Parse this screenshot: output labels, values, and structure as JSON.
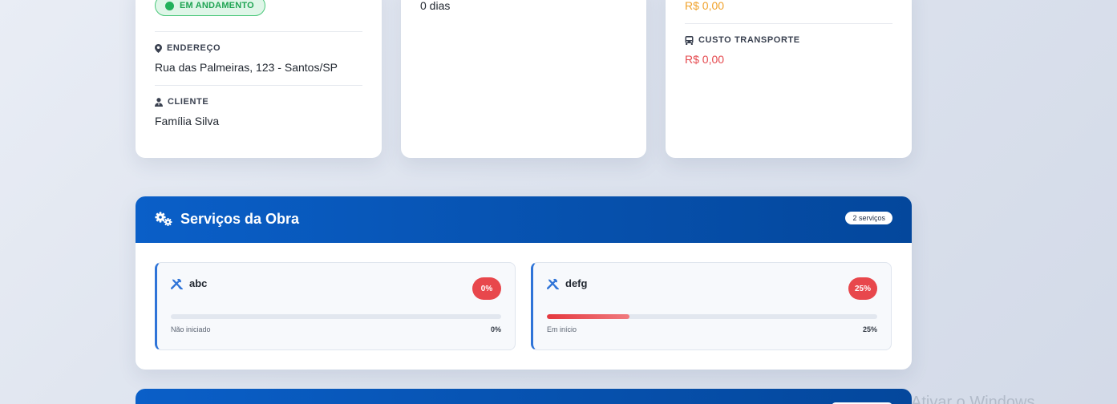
{
  "info_card": {
    "status": "EM ANDAMENTO",
    "address_label": "ENDEREÇO",
    "address_value": "Rua das Palmeiras, 123 - Santos/SP",
    "client_label": "CLIENTE",
    "client_value": "Família Silva"
  },
  "duration_card": {
    "value": "0 dias"
  },
  "costs_card": {
    "top_value": "R$ 0,00",
    "transport_label": "CUSTO TRANSPORTE",
    "transport_value": "R$ 0,00"
  },
  "services": {
    "title": "Serviços da Obra",
    "count_badge": "2 serviços",
    "items": [
      {
        "name": "abc",
        "percent_label": "0%",
        "progress": 0,
        "status": "Não iniciado"
      },
      {
        "name": "defg",
        "percent_label": "25%",
        "progress": 0.25,
        "status": "Em início"
      }
    ]
  },
  "watermark": "Ativar o Windows",
  "colors": {
    "accent_blue": "#0a5fc8",
    "status_green": "#22b15a",
    "money_orange": "#f0a12a",
    "money_red": "#e5484d",
    "badge_red": "#e8474c"
  }
}
